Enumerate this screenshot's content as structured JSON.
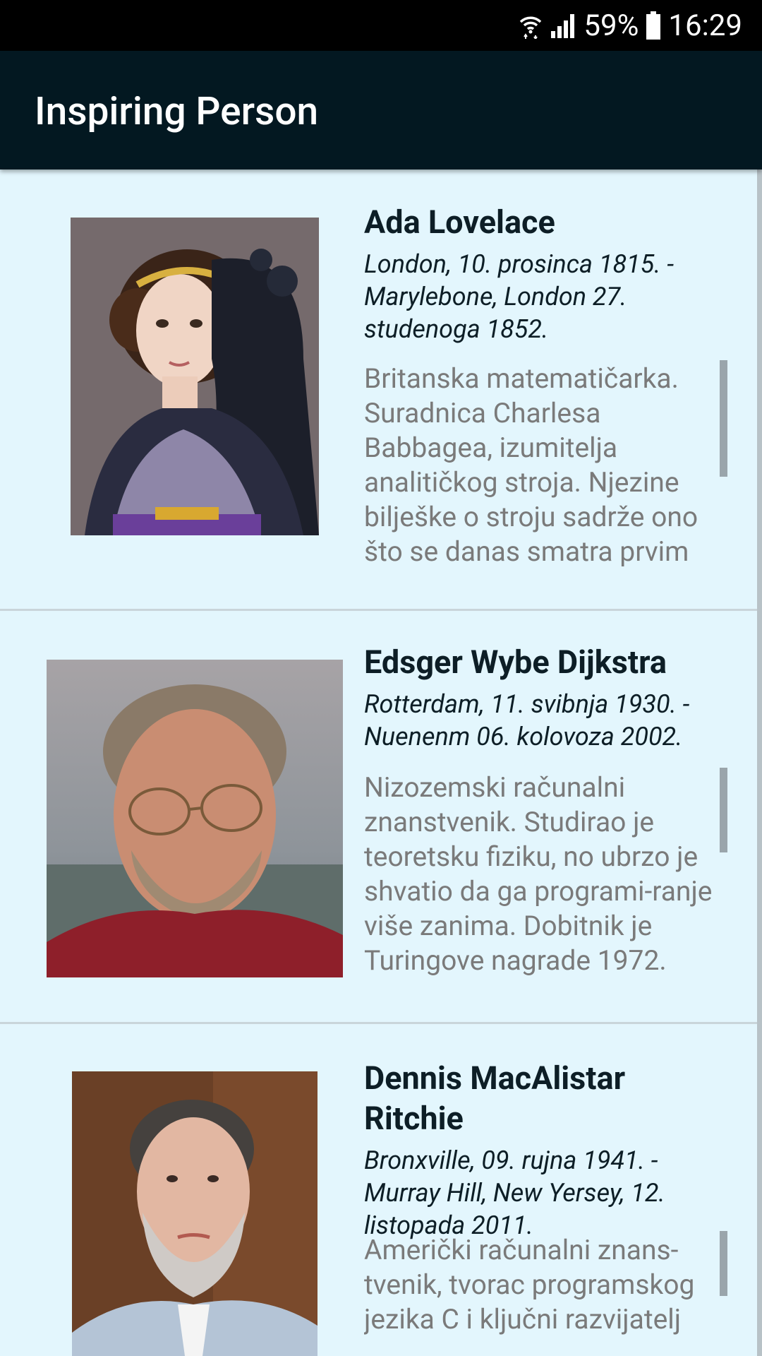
{
  "status_bar": {
    "battery": "59%",
    "time": "16:29"
  },
  "app_bar": {
    "title": "Inspiring Person"
  },
  "persons": [
    {
      "name": "Ada Lovelace",
      "dates": "London, 10. prosinca 1815. - Marylebone, London 27. studenoga 1852.",
      "description": "Britanska matematičarka. Suradnica Charlesa Babbagea, izumitelja analitičkog stroja. Njezine bilješke o stroju sadrže ono što se danas smatra prvim"
    },
    {
      "name": "Edsger Wybe Dijkstra",
      "dates": "Rotterdam, 11. svibnja 1930. - Nuenenm 06. kolovoza 2002.",
      "description": "Nizozemski računalni znanstvenik. Studirao je teoretsku fiziku, no ubrzo je shvatio da ga programi-ranje više zanima. Dobitnik je Turingove nagrade 1972."
    },
    {
      "name": "Dennis MacAlistar Ritchie",
      "dates": "Bronxville, 09. rujna 1941. - Murray Hill, New Yersey, 12. listopada 2011.",
      "description": "Američki računalni znans-tvenik, tvorac programskog jezika C i ključni razvijatelj"
    }
  ]
}
